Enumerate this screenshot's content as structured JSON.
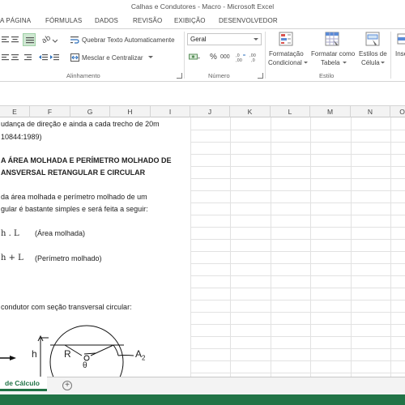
{
  "window": {
    "title": "Calhas e Condutores - Macro - Microsoft Excel"
  },
  "tabs": [
    "A PÁGINA",
    "FÓRMULAS",
    "DADOS",
    "REVISÃO",
    "EXIBIÇÃO",
    "DESENVOLVEDOR"
  ],
  "ribbon": {
    "alignment": {
      "wrap_text": "Quebrar Texto Automaticamente",
      "merge_center": "Mesclar e Centralizar",
      "label": "Alinhamento"
    },
    "number": {
      "format": "Geral",
      "percent": "%",
      "thousands": "000",
      "label": "Número"
    },
    "styles": {
      "conditional_line1": "Formatação",
      "conditional_line2": "Condicional",
      "table_line1": "Formatar como",
      "table_line2": "Tabela",
      "cell_line1": "Estilos de",
      "cell_line2": "Célula",
      "label": "Estilo"
    },
    "insert": "Inse"
  },
  "columns": [
    "E",
    "F",
    "G",
    "H",
    "I",
    "J",
    "K",
    "L",
    "M",
    "N",
    "O"
  ],
  "cells": {
    "line1": "udança de direção e ainda a cada trecho de 20m",
    "line2": "10844:1989)",
    "heading1": "A ÁREA MOLHADA E PERÍMETRO MOLHADO DE",
    "heading2": "ANSVERSAL RETANGULAR E CIRCULAR",
    "para1": "da área molhada e perímetro molhado de um",
    "para2": "gular é bastante simples e será feita a seguir:",
    "formula1": "h . L",
    "formula1_label": "(Área molhada)",
    "formula2": "h + L",
    "formula2_label": "(Perímetro molhado)",
    "circular": "condutor com seção transversal circular:"
  },
  "diagram": {
    "label_h": "h",
    "label_R": "R",
    "label_theta": "θ",
    "label_A2": "A2"
  },
  "sheet": {
    "active_tab": "de Cálculo",
    "add_symbol": "+"
  }
}
